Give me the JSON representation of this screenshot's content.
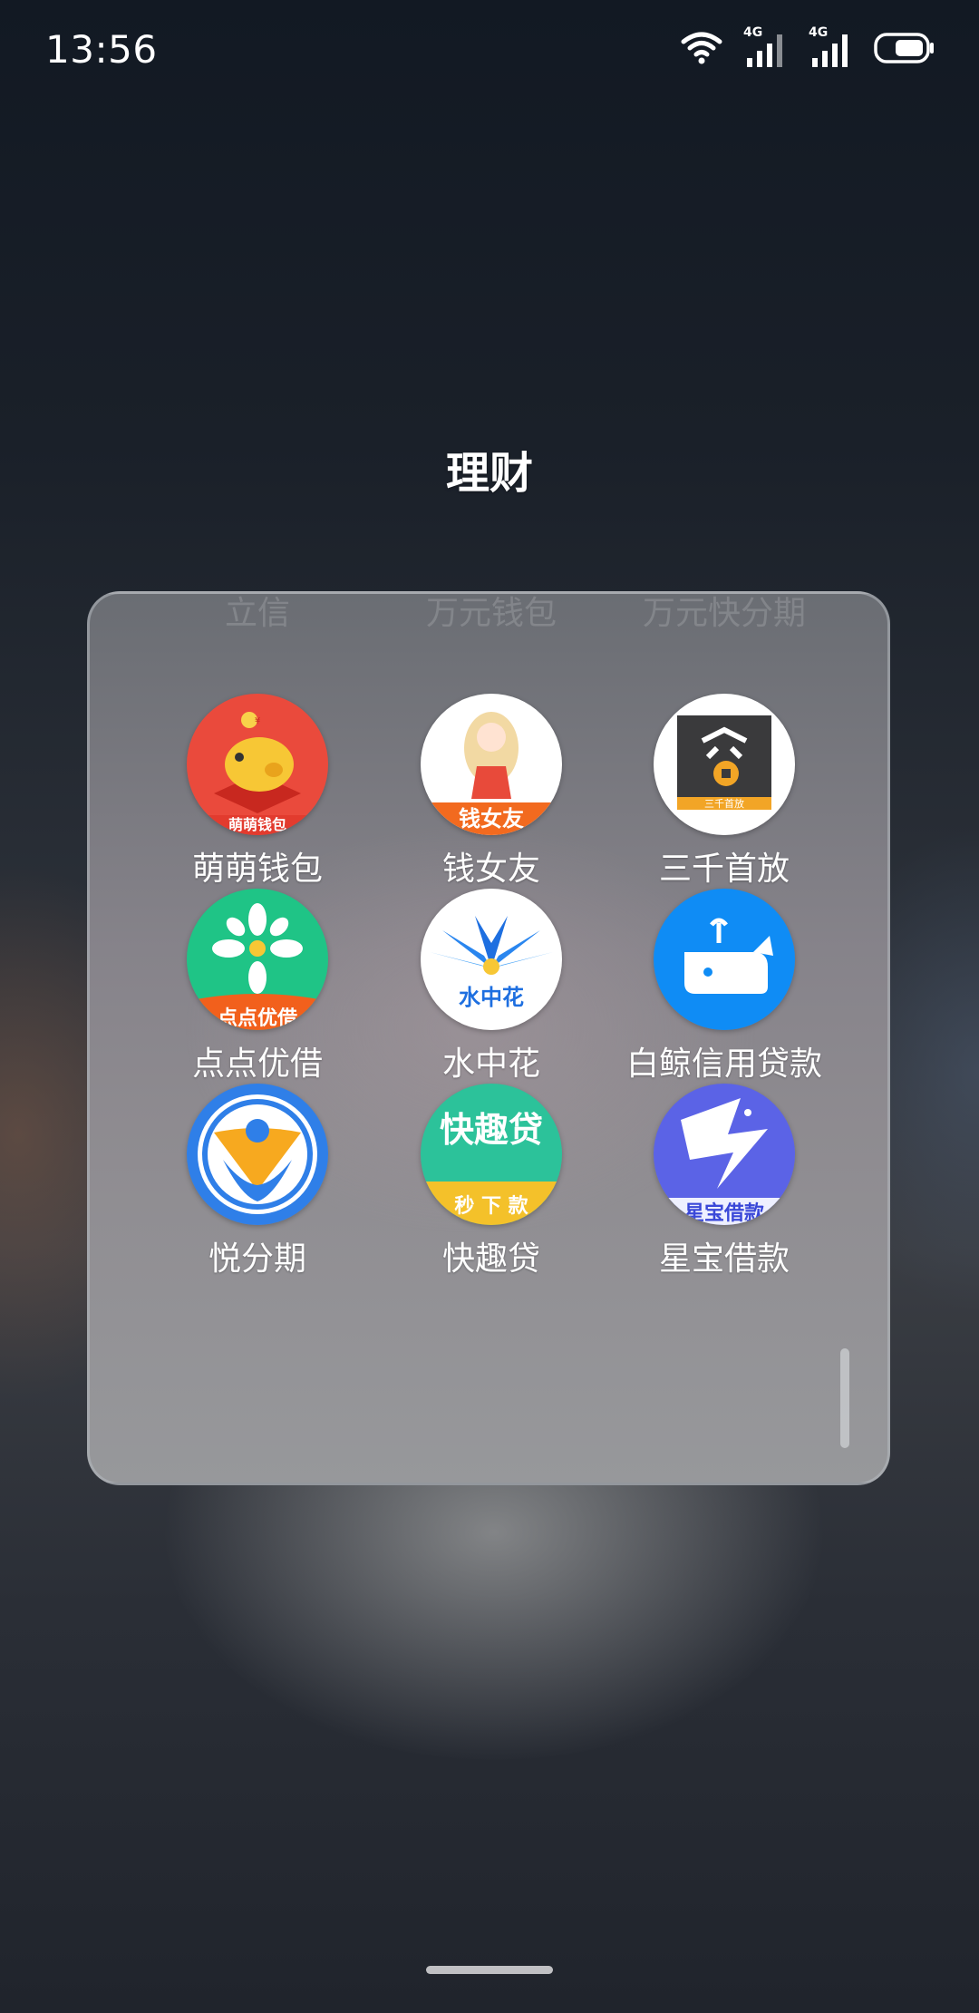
{
  "status_bar": {
    "time": "13:56",
    "network_1": "4G",
    "network_2": "4G",
    "icons": [
      "wifi-icon",
      "signal-icon",
      "signal-icon",
      "battery-icon"
    ]
  },
  "folder": {
    "title": "理财",
    "faded_row": [
      "立信",
      "万元钱包",
      "万元快分期"
    ],
    "apps": [
      {
        "label": "萌萌钱包",
        "icon": "piggy-bank-icon",
        "badge": "萌萌钱包"
      },
      {
        "label": "钱女友",
        "icon": "girl-icon",
        "badge": "钱女友"
      },
      {
        "label": "三千首放",
        "icon": "coin-stamp-icon",
        "badge": "三千首放"
      },
      {
        "label": "点点优借",
        "icon": "flower-icon",
        "badge": "点点优借"
      },
      {
        "label": "水中花",
        "icon": "lotus-icon",
        "badge": "水中花"
      },
      {
        "label": "白鲸信用贷款",
        "icon": "whale-icon"
      },
      {
        "label": "悦分期",
        "icon": "person-shield-icon"
      },
      {
        "label": "快趣贷",
        "icon": "text-logo-icon",
        "badge": "快趣贷",
        "badge2": "秒 下 款"
      },
      {
        "label": "星宝借款",
        "icon": "star-bird-icon",
        "badge": "星宝借款"
      }
    ]
  },
  "colors": {
    "background_top": "#121923",
    "panel": "#86838a",
    "text": "#ffffff"
  }
}
